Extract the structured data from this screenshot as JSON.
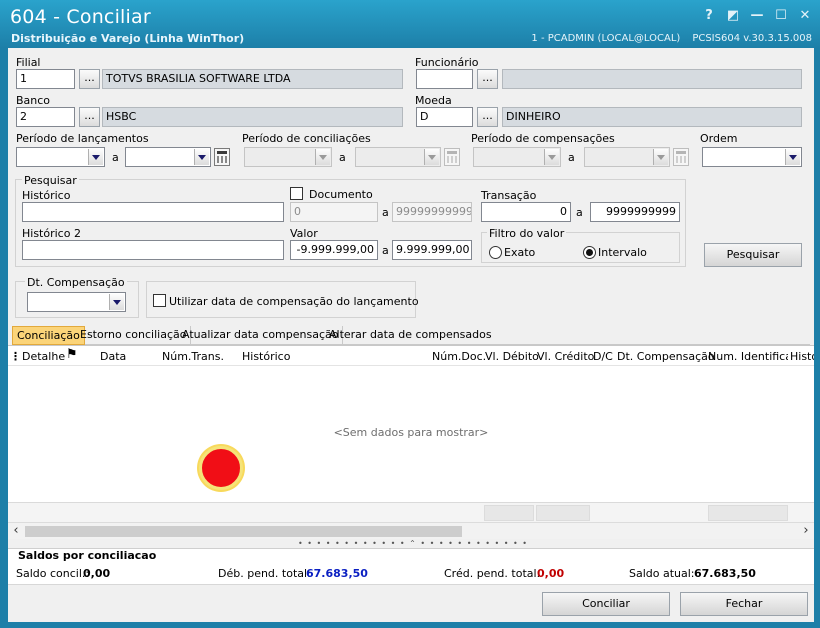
{
  "window": {
    "title": "604 - Conciliar",
    "subtitle": "Distribuição e Varejo (Linha WinThor)",
    "status_user": "1 - PCADMIN (LOCAL@LOCAL)",
    "status_version": "PCSIS604  v.30.3.15.008",
    "controls": [
      "?",
      "◩",
      "—",
      "☐",
      "✕"
    ]
  },
  "form": {
    "filial_label": "Filial",
    "filial_code": "1",
    "filial_name": "TOTVS BRASILIA SOFTWARE LTDA",
    "funcionario_label": "Funcionário",
    "funcionario_code": "",
    "funcionario_name": "",
    "banco_label": "Banco",
    "banco_code": "2",
    "banco_name": "HSBC",
    "moeda_label": "Moeda",
    "moeda_code": "D",
    "moeda_name": "DINHEIRO",
    "lookup_label": "...",
    "periodo_lanc_label": "Período de lançamentos",
    "periodo_conc_label": "Período de conciliações",
    "periodo_comp_label": "Período de compensações",
    "ordem_label": "Ordem",
    "range_sep": "a"
  },
  "pesquisar": {
    "group_label": "Pesquisar",
    "historico_label": "Histórico",
    "historico_value": "",
    "documento_label": "Documento",
    "documento_from": "0",
    "documento_to": "99999999999",
    "transacao_label": "Transação",
    "transacao_from": "0",
    "transacao_to": "9999999999",
    "historico2_label": "Histórico 2",
    "historico2_value": "",
    "valor_label": "Valor",
    "valor_from": "-9.999.999,00",
    "valor_to": "9.999.999,00",
    "filtro_label": "Filtro do valor",
    "filtro_exato": "Exato",
    "filtro_intervalo": "Intervalo",
    "filtro_selected": "Intervalo",
    "search_button": "Pesquisar",
    "sep": "a"
  },
  "dtcomp": {
    "label": "Dt. Compensação",
    "checkbox_label": "Utilizar data de compensação do lançamento"
  },
  "tabs": [
    {
      "label": "Conciliação",
      "active": true
    },
    {
      "label": "Estorno conciliação",
      "active": false
    },
    {
      "label": "Atualizar data compensação",
      "active": false
    },
    {
      "label": "Alterar data de compensados",
      "active": false
    }
  ],
  "grid": {
    "columns": [
      "Detalhe",
      "Data",
      "Núm.Trans.",
      "Histórico",
      "Núm.Doc.",
      "Vl. Débito",
      "Vl. Crédito",
      "D/C",
      "Dt. Compensação",
      "Num. Identificaç",
      "Histó"
    ],
    "empty_text": "<Sem dados para mostrar>"
  },
  "saldos": {
    "title": "Saldos por conciliacao",
    "concil_label": "Saldo concil.:",
    "concil_value": "0,00",
    "deb_label": "Déb. pend. total:",
    "deb_value": "67.683,50",
    "cred_label": "Créd. pend. total:",
    "cred_value": "0,00",
    "atual_label": "Saldo atual:",
    "atual_value": "67.683,50"
  },
  "buttons": {
    "conciliar": "Conciliar",
    "fechar": "Fechar"
  },
  "colors": {
    "titlebar": "#1d7fa8",
    "active_tab": "#fbd479",
    "debit_value": "#0a1fc2",
    "credit_value": "#c00000"
  }
}
